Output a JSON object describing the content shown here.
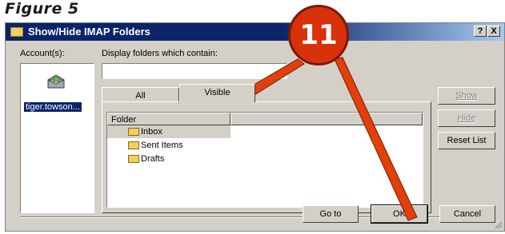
{
  "figure": {
    "title": "Figure 5"
  },
  "window": {
    "title": "Show/Hide IMAP Folders",
    "help_button": "?",
    "close_button": "X"
  },
  "accounts": {
    "label": "Account(s):",
    "items": [
      {
        "label": "tiger.towson...",
        "selected": true
      }
    ]
  },
  "filter": {
    "label": "Display folders which contain:",
    "value": ""
  },
  "tabs": [
    {
      "label": "All",
      "active": false
    },
    {
      "label": "Visible",
      "active": true
    }
  ],
  "folder_list": {
    "column_header": "Folder",
    "rows": [
      {
        "label": "Inbox",
        "selected": true
      },
      {
        "label": "Sent Items",
        "selected": false
      },
      {
        "label": "Drafts",
        "selected": false
      }
    ]
  },
  "side_buttons": {
    "show": {
      "label": "Show",
      "enabled": false
    },
    "hide": {
      "label": "Hide",
      "enabled": false
    },
    "reset": {
      "label": "Reset List",
      "enabled": true
    }
  },
  "footer_buttons": {
    "goto": "Go to",
    "ok": "OK",
    "cancel": "Cancel"
  },
  "callout": {
    "number": "11",
    "color": "#d9310b"
  },
  "colors": {
    "title_bar": "#0a246a",
    "dialog_bg": "#d4d0c8",
    "arrow": "#e0400a"
  }
}
